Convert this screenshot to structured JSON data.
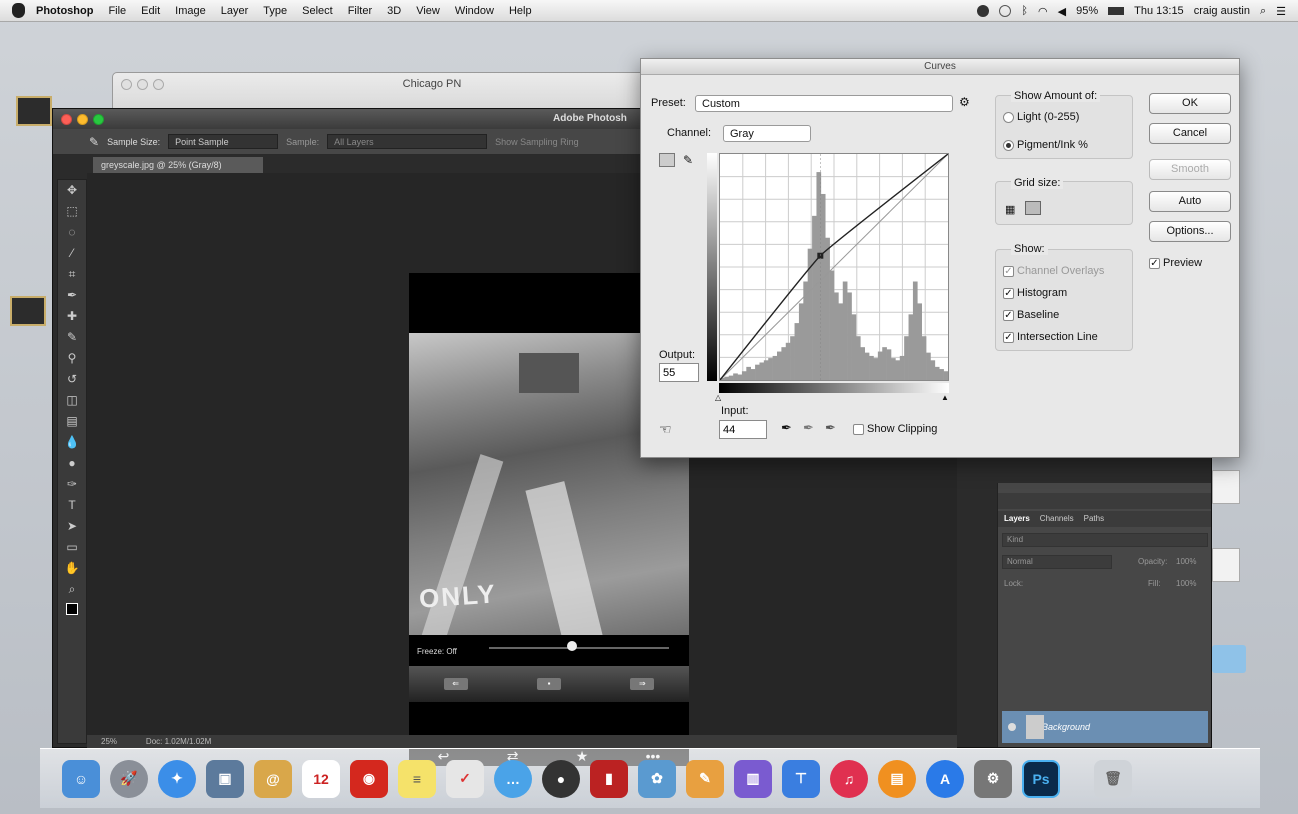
{
  "menubar": {
    "app": "Photoshop",
    "items": [
      "File",
      "Edit",
      "Image",
      "Layer",
      "Type",
      "Select",
      "Filter",
      "3D",
      "View",
      "Window",
      "Help"
    ],
    "battery": "95%",
    "clock": "Thu 13:15",
    "user": "craig austin"
  },
  "finder": {
    "title": "Chicago PN"
  },
  "photoshop": {
    "title": "Adobe Photosh",
    "options": {
      "sample_size_label": "Sample Size:",
      "sample_size_value": "Point Sample",
      "sample_label": "Sample:",
      "sample_value": "All Layers",
      "show_sampling_ring": "Show Sampling Ring"
    },
    "doc_tab": "greyscale.jpg @ 25% (Gray/8)",
    "status": {
      "zoom": "25%",
      "doc": "Doc: 1.02M/1.02M"
    },
    "image": {
      "freeze": "Freeze: Off",
      "road_text": "ONLY"
    },
    "layers": {
      "tabs": [
        "Layers",
        "Channels",
        "Paths"
      ],
      "kind": "Kind",
      "blend": "Normal",
      "opacity_label": "Opacity:",
      "opacity": "100%",
      "lock_label": "Lock:",
      "fill_label": "Fill:",
      "fill": "100%",
      "layer_name": "Background"
    }
  },
  "curves": {
    "title": "Curves",
    "preset_label": "Preset:",
    "preset_value": "Custom",
    "channel_label": "Channel:",
    "channel_value": "Gray",
    "output_label": "Output:",
    "output_value": "55",
    "input_label": "Input:",
    "input_value": "44",
    "show_clipping": "Show Clipping",
    "show_amount": {
      "label": "Show Amount of:",
      "light": "Light (0-255)",
      "pigment": "Pigment/Ink %"
    },
    "grid_size": "Grid size:",
    "show": {
      "label": "Show:",
      "channel_overlays": "Channel Overlays",
      "histogram": "Histogram",
      "baseline": "Baseline",
      "intersection": "Intersection Line"
    },
    "buttons": {
      "ok": "OK",
      "cancel": "Cancel",
      "smooth": "Smooth",
      "auto": "Auto",
      "options": "Options..."
    },
    "preview": "Preview",
    "histogram": [
      2,
      3,
      4,
      6,
      5,
      8,
      12,
      10,
      14,
      16,
      18,
      20,
      22,
      26,
      30,
      34,
      40,
      52,
      70,
      90,
      120,
      150,
      190,
      170,
      130,
      100,
      80,
      70,
      90,
      80,
      60,
      40,
      30,
      25,
      22,
      20,
      26,
      30,
      28,
      20,
      18,
      22,
      40,
      60,
      90,
      70,
      40,
      25,
      18,
      12,
      10,
      8
    ],
    "curve": {
      "point": [
        44,
        55
      ]
    }
  },
  "calendar_day": "12",
  "ps_icon": "Ps"
}
